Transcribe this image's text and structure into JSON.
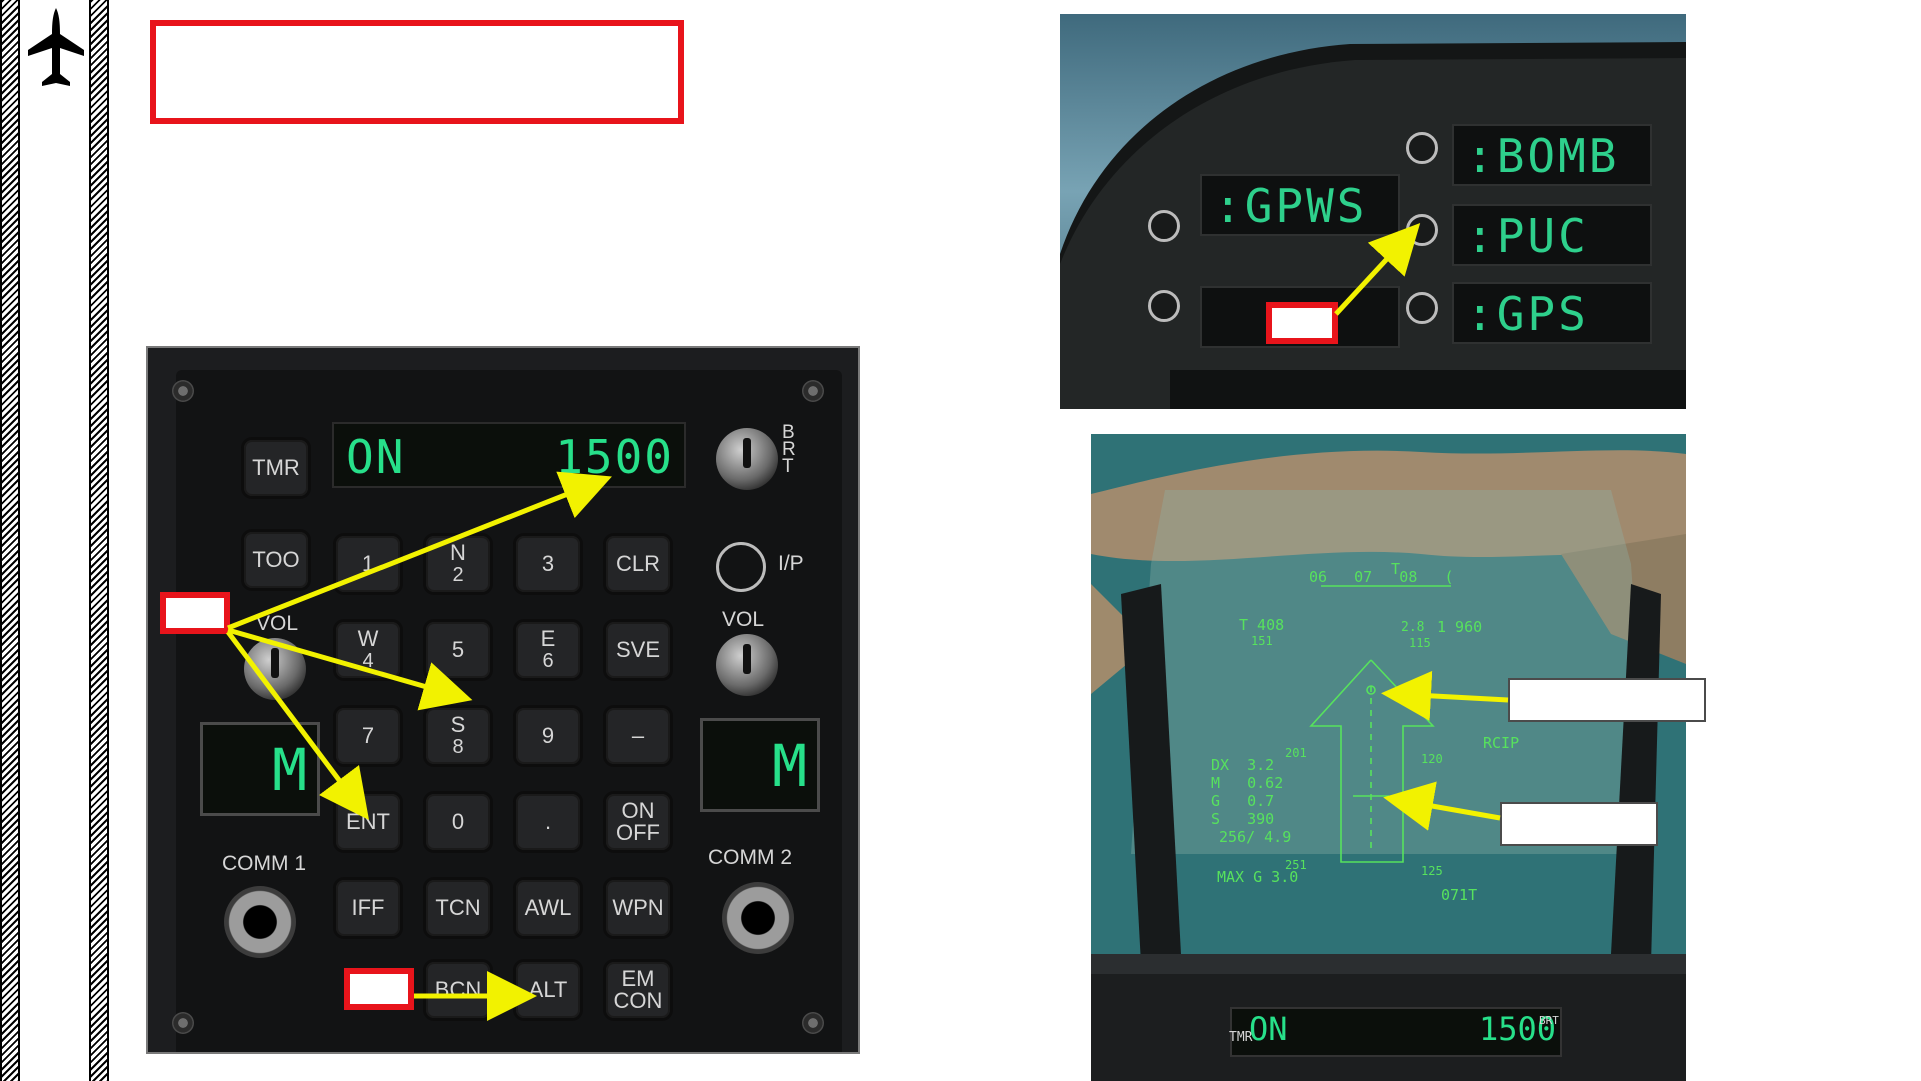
{
  "ufc": {
    "scratchpad": {
      "left": "ON",
      "right": "1500"
    },
    "option_label": "I/P",
    "brt_label": "BRT",
    "vol_left_label": "VOL",
    "vol_right_label": "VOL",
    "comm1_display": "M",
    "comm2_display": "M",
    "comm1_label": "COMM 1",
    "comm2_label": "COMM 2",
    "keys": {
      "tmr": "TMR",
      "too": "TOO",
      "k1": "1",
      "k2_top": "N",
      "k2": "2",
      "k3": "3",
      "clr": "CLR",
      "k4_top": "W",
      "k4": "4",
      "k5": "5",
      "k6_top": "E",
      "k6": "6",
      "sve": "SVE",
      "k7": "7",
      "k8_top": "S",
      "k8": "8",
      "k9": "9",
      "dash": "–",
      "ent": "ENT",
      "k0": "0",
      "dot": ".",
      "onoff_1": "ON",
      "onoff_2": "OFF",
      "iff": "IFF",
      "tcn": "TCN",
      "awl": "AWL",
      "wpn": "WPN",
      "bcn": "BCN",
      "alt": "ALT",
      "emcon_1": "EM",
      "emcon_2": "CON"
    }
  },
  "ifei": {
    "left_lower_blank": "",
    "gpws": ":GPWS",
    "bomb": ":BOMB",
    "puc": ":PUC",
    "gps": ":GPS"
  },
  "hud": {
    "heading_tape": "06   07   08   (",
    "heading_marker": "T",
    "left_readout": "T 408",
    "left_sub": "151",
    "right_readout": "1 960",
    "center_alt": "2.8",
    "center_sub": "115",
    "mode": "RCIP",
    "dx": "DX  3.2",
    "mach": "M   0.62",
    "g": "G   0.7",
    "s": "S   390",
    "wind": "256/ 4.9",
    "maxg": "MAX G 3.0",
    "ladder_201": "201",
    "ladder_120": "120",
    "ladder_251": "251",
    "ladder_125": "125",
    "range": "071T",
    "bottom_ufc_left": "ON",
    "bottom_ufc_right": "1500",
    "bottom_tmr": "TMR",
    "bottom_brt": "BRT"
  },
  "colors": {
    "callout_red": "#e8141b",
    "arrow_yellow": "#f2f200",
    "lcd_green": "#27e08a"
  }
}
